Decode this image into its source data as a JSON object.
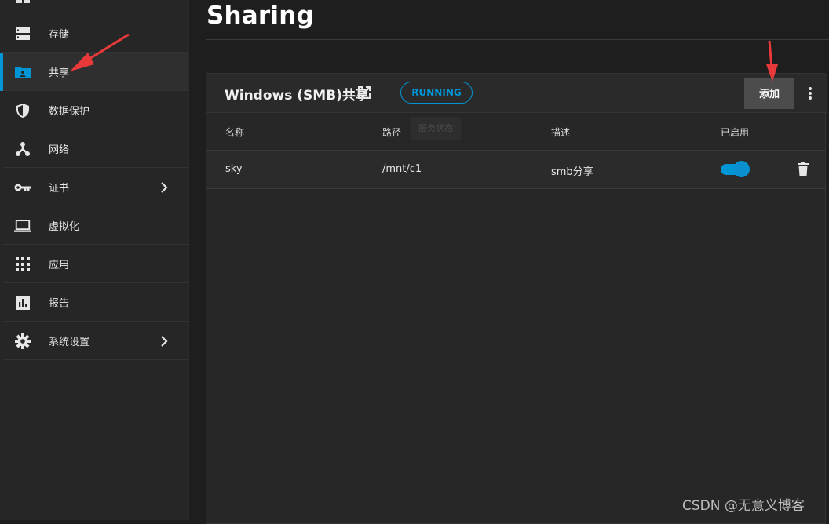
{
  "sidebar": {
    "items": [
      {
        "label": "存储",
        "icon": "storage-icon"
      },
      {
        "label": "共享",
        "icon": "shared-folder-icon",
        "active": true
      },
      {
        "label": "数据保护",
        "icon": "shield-icon"
      },
      {
        "label": "网络",
        "icon": "network-icon"
      },
      {
        "label": "证书",
        "icon": "key-icon",
        "has_children": true
      },
      {
        "label": "虚拟化",
        "icon": "laptop-icon"
      },
      {
        "label": "应用",
        "icon": "apps-grid-icon"
      },
      {
        "label": "报告",
        "icon": "report-chart-icon"
      },
      {
        "label": "系统设置",
        "icon": "gear-icon",
        "has_children": true
      }
    ]
  },
  "page": {
    "title": "Sharing"
  },
  "card": {
    "title": "Windows (SMB)共享",
    "status": "RUNNING",
    "add_label": "添加",
    "tooltip": "服务状态"
  },
  "table": {
    "columns": [
      "名称",
      "路径",
      "描述",
      "已启用"
    ],
    "rows": [
      {
        "name": "sky",
        "path": "/mnt/c1",
        "description": "smb分享",
        "enabled": true
      }
    ]
  },
  "watermark": "CSDN @无意义博客",
  "colors": {
    "accent": "#0095d5",
    "annotation_arrow": "#e83a3a",
    "background": "#1e1e1e",
    "sidebar": "#262626"
  }
}
